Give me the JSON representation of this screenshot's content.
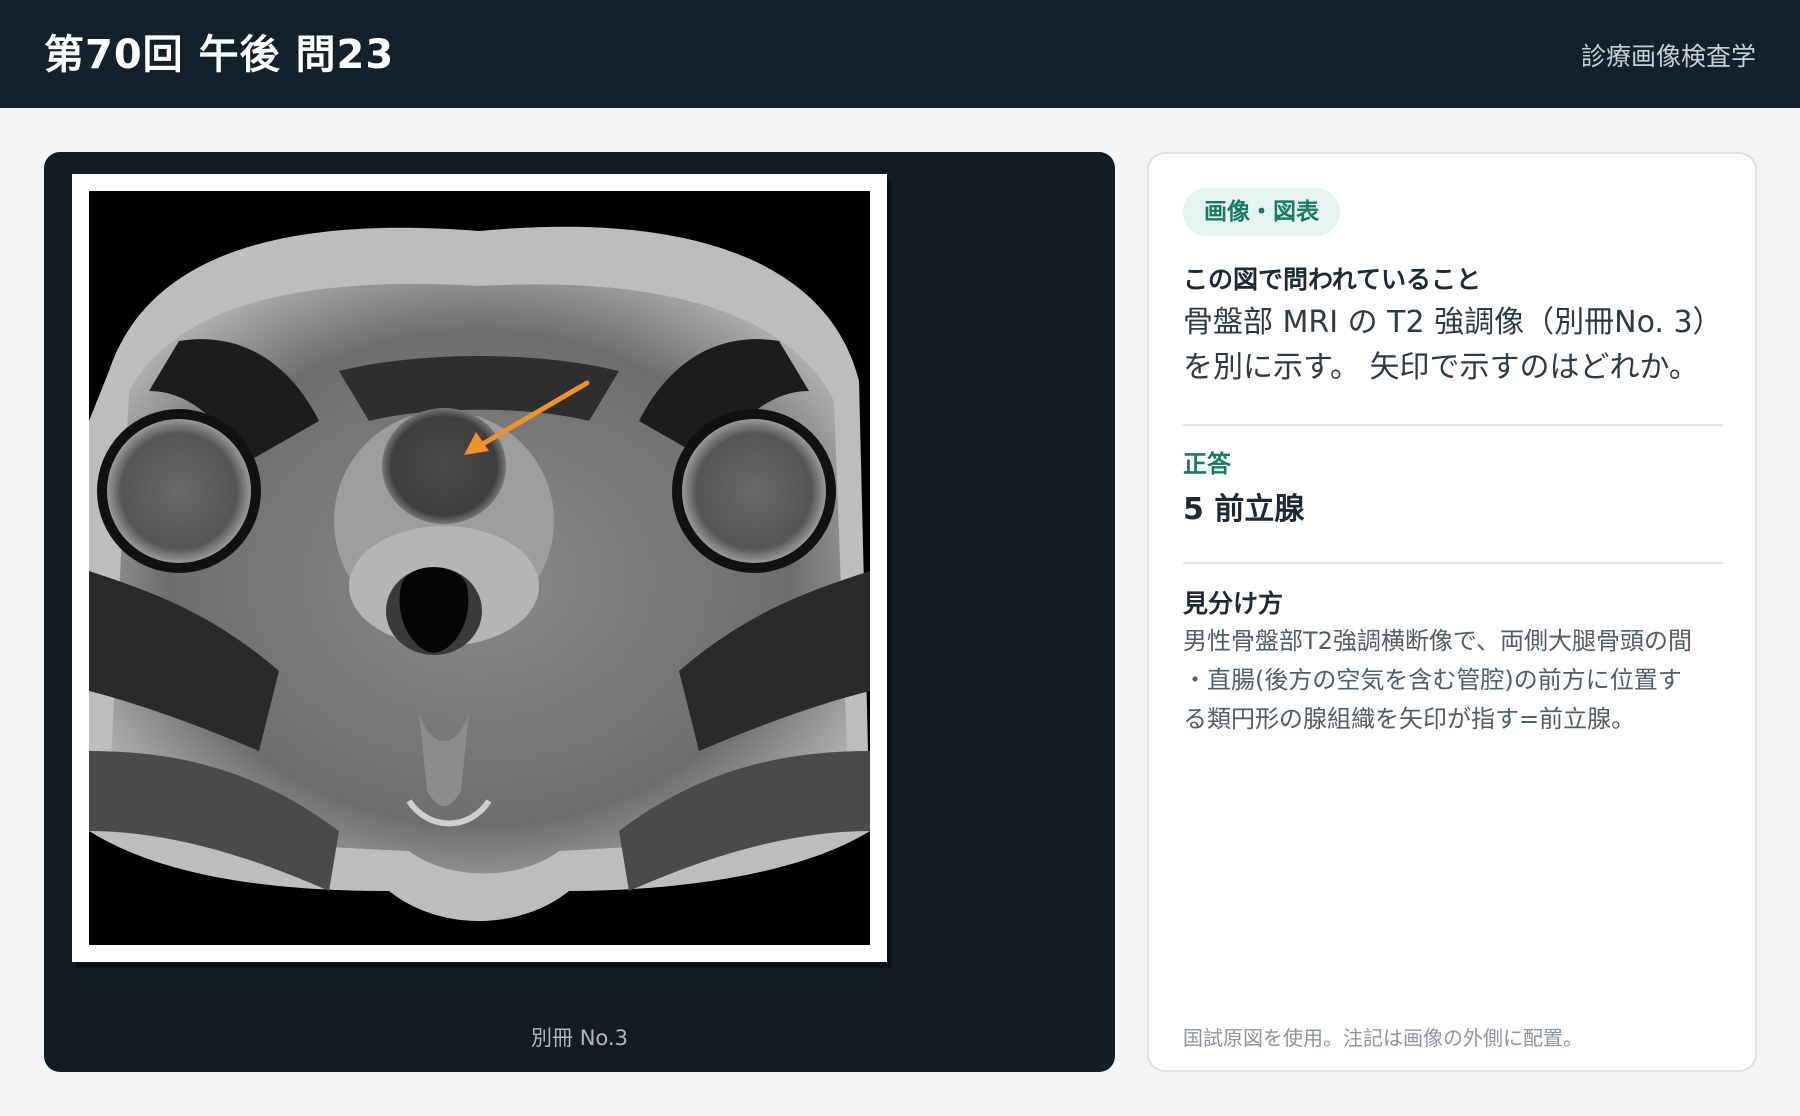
{
  "header": {
    "title": "第70回 午後 問23",
    "subject": "診療画像検査学"
  },
  "viewer": {
    "caption": "別冊 No.3",
    "image": {
      "description_icon": "mri-pelvis-axial-image",
      "arrow_color": "#f0922c"
    }
  },
  "card": {
    "badge": "画像・図表",
    "question_heading": "この図で問われていること",
    "question_line1": "骨盤部 MRI の T2 強調像（別冊No. 3）",
    "question_line2": "を別に示す。 矢印で示すのはどれか。",
    "answer_heading": "正答",
    "answer": "5 前立腺",
    "how_heading": "見分け方",
    "how_line1": "男性骨盤部T2強調横断像で、両側大腿骨頭の間",
    "how_line2": "・直腸(後方の空気を含む管腔)の前方に位置す",
    "how_line3": "る類円形の腺組織を矢印が指す=前立腺。",
    "footnote": "国試原図を使用。注記は画像の外側に配置。"
  },
  "colors": {
    "topbar": "#15212a",
    "accent": "#177a63",
    "badge_bg": "#e5f4f0",
    "viewer_bg": "#121c24"
  }
}
